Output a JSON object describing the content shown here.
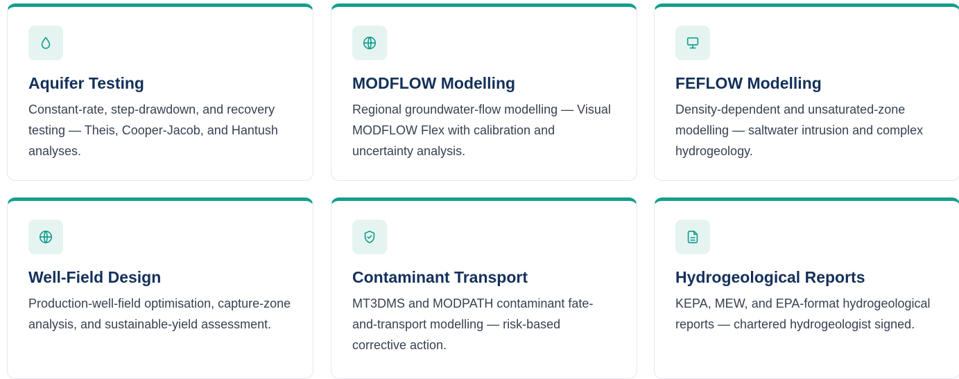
{
  "accent_color": "#149e8e",
  "title_color": "#13305a",
  "cards": [
    {
      "icon": "droplet-icon",
      "title": "Aquifer Testing",
      "description": "Constant-rate, step-drawdown, and recovery testing — Theis, Cooper-Jacob, and Hantush analyses."
    },
    {
      "icon": "globe-icon",
      "title": "MODFLOW Modelling",
      "description": "Regional groundwater-flow modelling — Visual MODFLOW Flex with calibration and uncertainty analysis."
    },
    {
      "icon": "monitor-icon",
      "title": "FEFLOW Modelling",
      "description": "Density-dependent and unsaturated-zone modelling — saltwater intrusion and complex hydrogeology."
    },
    {
      "icon": "globe-icon",
      "title": "Well-Field Design",
      "description": "Production-well-field optimisation, capture-zone analysis, and sustainable-yield assessment."
    },
    {
      "icon": "shield-check-icon",
      "title": "Contaminant Transport",
      "description": "MT3DMS and MODPATH contaminant fate-and-transport modelling — risk-based corrective action."
    },
    {
      "icon": "file-text-icon",
      "title": "Hydrogeological Reports",
      "description": "KEPA, MEW, and EPA-format hydrogeological reports — chartered hydrogeologist signed."
    }
  ]
}
